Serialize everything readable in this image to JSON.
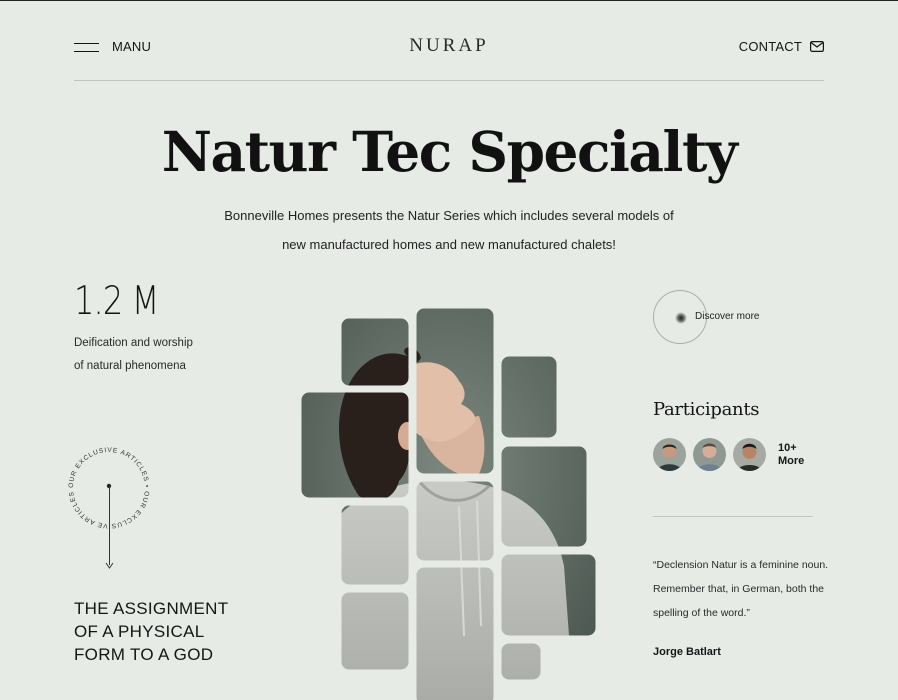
{
  "header": {
    "menu_label": "MANU",
    "logo": "NURAP",
    "contact_label": "CONTACT"
  },
  "hero": {
    "title": "Natur Tec Specialty",
    "lead_line1": "Bonneville Homes presents the Natur Series which includes several models of",
    "lead_line2": "new manufactured homes and new manufactured chalets!"
  },
  "stat": {
    "value": "1.2 M",
    "desc_line1": "Deification and worship",
    "desc_line2": "of natural phenomena"
  },
  "badge": {
    "circular_text": "OUR EXCLUSIVE ARTICLES • OUR EXCLUSIVE ARTICLES •"
  },
  "assignment": {
    "line1": "THE ASSIGNMENT",
    "line2": "OF A PHYSICAL",
    "line3": "FORM TO A GOD"
  },
  "discover": {
    "label": "Discover more"
  },
  "participants": {
    "title": "Participants",
    "more_line1": "10+",
    "more_line2": "More"
  },
  "quote": {
    "text": "“Declension Natur is a feminine noun. Remember that, in German, both the spelling of the word.”",
    "author": "Jorge Batlart"
  },
  "colors": {
    "background": "#e6ebe6",
    "text": "#141414",
    "rule": "#bfc5bf"
  },
  "icons": {
    "menu": "hamburger-icon",
    "contact": "envelope-icon",
    "arrow": "arrow-down-icon"
  }
}
